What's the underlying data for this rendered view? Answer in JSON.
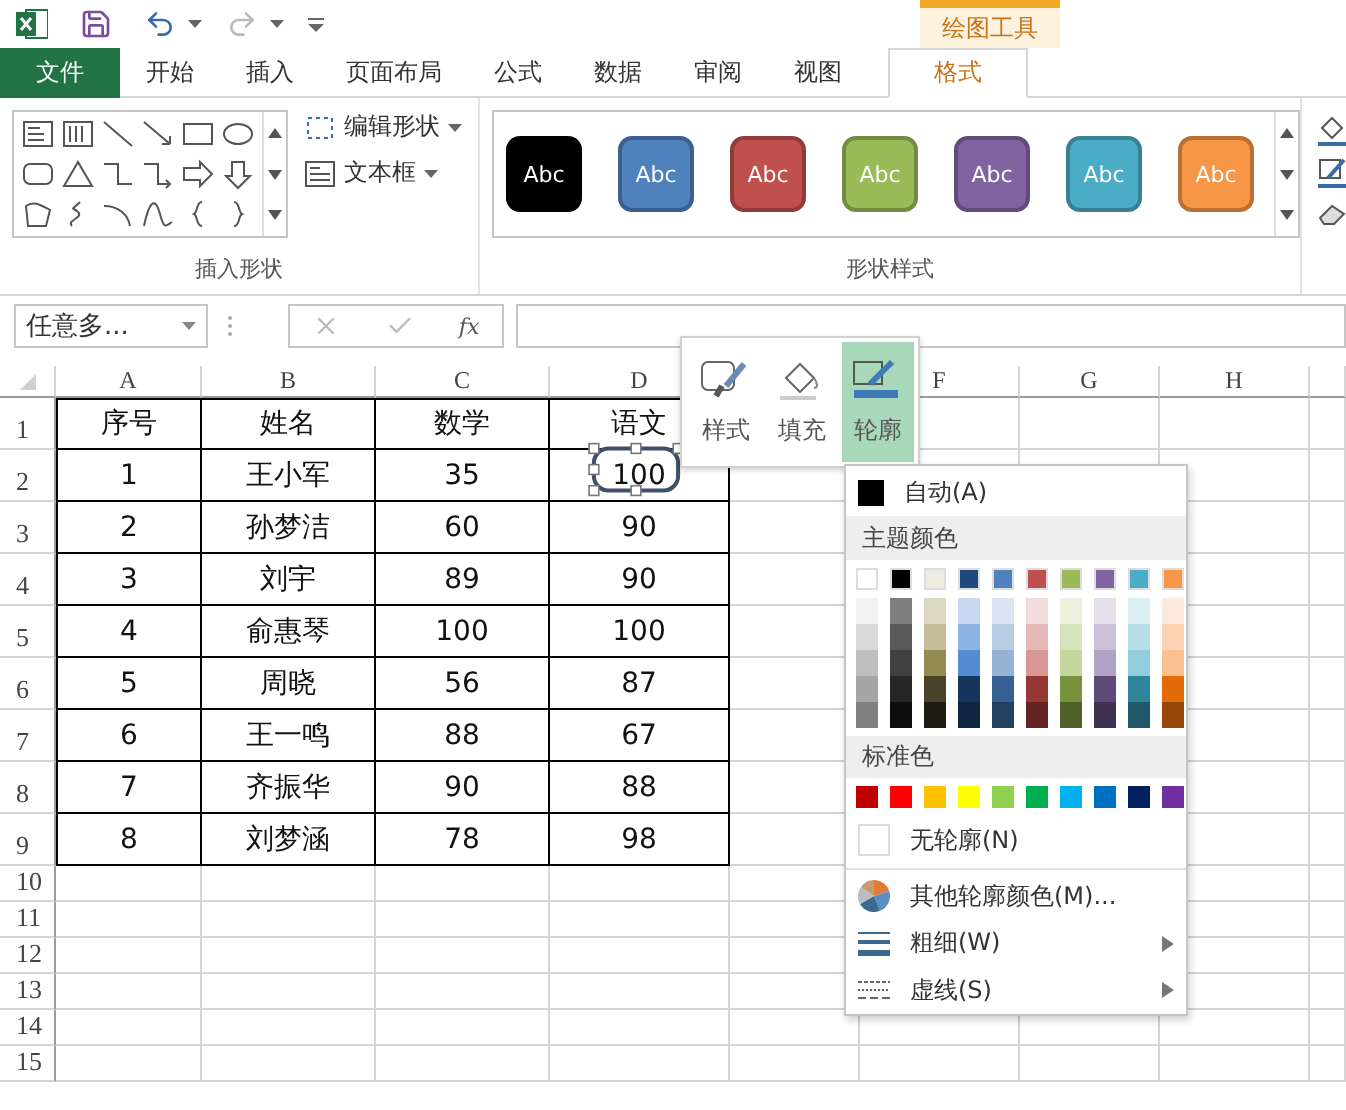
{
  "context_tab_group": "绘图工具",
  "tabs": [
    {
      "label": "文件",
      "kind": "file",
      "selected": false
    },
    {
      "label": "开始",
      "kind": "tab",
      "selected": false
    },
    {
      "label": "插入",
      "kind": "tab",
      "selected": false
    },
    {
      "label": "页面布局",
      "kind": "tab",
      "selected": false
    },
    {
      "label": "公式",
      "kind": "tab",
      "selected": false
    },
    {
      "label": "数据",
      "kind": "tab",
      "selected": false
    },
    {
      "label": "审阅",
      "kind": "tab",
      "selected": false
    },
    {
      "label": "视图",
      "kind": "tab",
      "selected": false
    },
    {
      "label": "格式",
      "kind": "context",
      "selected": true
    }
  ],
  "ribbon": {
    "insert_shapes": {
      "label": "插入形状",
      "buttons": [
        "编辑形状",
        "文本框"
      ]
    },
    "shape_styles": {
      "label": "形状样式",
      "presets": [
        {
          "label": "Abc",
          "color": "#000000"
        },
        {
          "label": "Abc",
          "color": "#4f81bd"
        },
        {
          "label": "Abc",
          "color": "#c0504d"
        },
        {
          "label": "Abc",
          "color": "#9bbb59"
        },
        {
          "label": "Abc",
          "color": "#8064a2"
        },
        {
          "label": "Abc",
          "color": "#4bacc6"
        },
        {
          "label": "Abc",
          "color": "#f79646"
        }
      ]
    }
  },
  "formula_bar": {
    "name_box": "任意多...",
    "function_label": "fx"
  },
  "sheet": {
    "columns_left": [
      "A",
      "B",
      "C",
      "D"
    ],
    "columns_right": [
      "F",
      "G",
      "H"
    ],
    "rows": [
      {
        "number": "1",
        "cells": [
          "序号",
          "姓名",
          "数学",
          "语文"
        ]
      },
      {
        "number": "2",
        "cells": [
          "1",
          "王小军",
          "35",
          "100"
        ]
      },
      {
        "number": "3",
        "cells": [
          "2",
          "孙梦洁",
          "60",
          "90"
        ]
      },
      {
        "number": "4",
        "cells": [
          "3",
          "刘宇",
          "89",
          "90"
        ]
      },
      {
        "number": "5",
        "cells": [
          "4",
          "俞惠琴",
          "100",
          "100"
        ]
      },
      {
        "number": "6",
        "cells": [
          "5",
          "周晓",
          "56",
          "87"
        ]
      },
      {
        "number": "7",
        "cells": [
          "6",
          "王一鸣",
          "88",
          "67"
        ]
      },
      {
        "number": "8",
        "cells": [
          "7",
          "齐振华",
          "90",
          "88"
        ]
      },
      {
        "number": "9",
        "cells": [
          "8",
          "刘梦涵",
          "78",
          "98"
        ]
      },
      {
        "number": "10",
        "cells": []
      },
      {
        "number": "11",
        "cells": []
      },
      {
        "number": "12",
        "cells": []
      },
      {
        "number": "13",
        "cells": []
      },
      {
        "number": "14",
        "cells": []
      },
      {
        "number": "15",
        "cells": []
      }
    ]
  },
  "mini_toolbar": [
    {
      "label": "样式",
      "kind": "style",
      "selected": false
    },
    {
      "label": "填充",
      "kind": "fill",
      "selected": false
    },
    {
      "label": "轮廓",
      "kind": "outline",
      "selected": true
    }
  ],
  "outline_menu": {
    "automatic": {
      "label": "自动(A)",
      "color": "#000000"
    },
    "theme_heading": "主题颜色",
    "theme_colors": [
      {
        "color": "#ffffff",
        "shades": [
          {
            "color": "#f2f2f2"
          },
          {
            "color": "#d9d9d9"
          },
          {
            "color": "#bfbfbf"
          },
          {
            "color": "#a6a6a6"
          },
          {
            "color": "#808080"
          }
        ]
      },
      {
        "color": "#000000",
        "shades": [
          {
            "color": "#7f7f7f"
          },
          {
            "color": "#595959"
          },
          {
            "color": "#404040"
          },
          {
            "color": "#262626"
          },
          {
            "color": "#0d0d0d"
          }
        ]
      },
      {
        "color": "#eeece1",
        "shades": [
          {
            "color": "#ddd9c3"
          },
          {
            "color": "#c4bd97"
          },
          {
            "color": "#938953"
          },
          {
            "color": "#494429"
          },
          {
            "color": "#1d1b10"
          }
        ]
      },
      {
        "color": "#1f497d",
        "shades": [
          {
            "color": "#c6d9f0"
          },
          {
            "color": "#8db3e2"
          },
          {
            "color": "#548dd4"
          },
          {
            "color": "#17365d"
          },
          {
            "color": "#0f243e"
          }
        ]
      },
      {
        "color": "#4f81bd",
        "shades": [
          {
            "color": "#dbe5f1"
          },
          {
            "color": "#b8cce4"
          },
          {
            "color": "#95b3d7"
          },
          {
            "color": "#366092"
          },
          {
            "color": "#244061"
          }
        ]
      },
      {
        "color": "#c0504d",
        "shades": [
          {
            "color": "#f2dcdb"
          },
          {
            "color": "#e5b9b7"
          },
          {
            "color": "#d99694"
          },
          {
            "color": "#953734"
          },
          {
            "color": "#632423"
          }
        ]
      },
      {
        "color": "#9bbb59",
        "shades": [
          {
            "color": "#ebf1dd"
          },
          {
            "color": "#d7e3bc"
          },
          {
            "color": "#c3d69b"
          },
          {
            "color": "#76923c"
          },
          {
            "color": "#4f6128"
          }
        ]
      },
      {
        "color": "#8064a2",
        "shades": [
          {
            "color": "#e5e0ec"
          },
          {
            "color": "#ccc1d9"
          },
          {
            "color": "#b2a2c7"
          },
          {
            "color": "#5f497a"
          },
          {
            "color": "#3f3151"
          }
        ]
      },
      {
        "color": "#4bacc6",
        "shades": [
          {
            "color": "#dbeef3"
          },
          {
            "color": "#b7dde8"
          },
          {
            "color": "#92cddc"
          },
          {
            "color": "#31859b"
          },
          {
            "color": "#205867"
          }
        ]
      },
      {
        "color": "#f79646",
        "shades": [
          {
            "color": "#fdeada"
          },
          {
            "color": "#fbd5b5"
          },
          {
            "color": "#fac08f"
          },
          {
            "color": "#e36c09"
          },
          {
            "color": "#974806"
          }
        ]
      }
    ],
    "standard_heading": "标准色",
    "standard_colors": [
      {
        "color": "#c00000"
      },
      {
        "color": "#ff0000"
      },
      {
        "color": "#ffc000"
      },
      {
        "color": "#ffff00"
      },
      {
        "color": "#92d050"
      },
      {
        "color": "#00b050"
      },
      {
        "color": "#00b0f0"
      },
      {
        "color": "#0070c0"
      },
      {
        "color": "#002060"
      },
      {
        "color": "#7030a0"
      }
    ],
    "no_outline": "无轮廓(N)",
    "items": [
      {
        "label": "其他轮廓颜色(M)...",
        "kind": "colors",
        "submenu": false
      },
      {
        "label": "粗细(W)",
        "kind": "weight",
        "submenu": true
      },
      {
        "label": "虚线(S)",
        "kind": "dashes",
        "submenu": true
      }
    ]
  }
}
